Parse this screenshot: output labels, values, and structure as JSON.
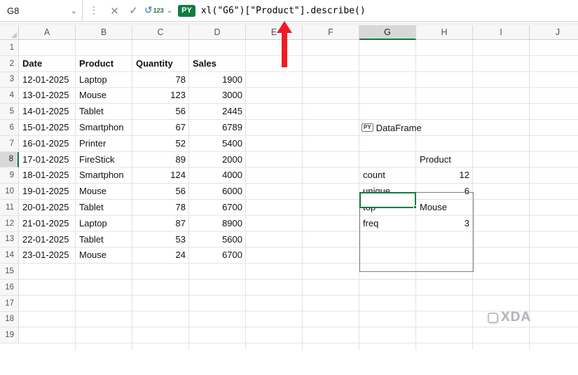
{
  "formula_bar": {
    "cell_reference": "G8",
    "formula": "xl(\"G6\")[\"Product\"].describe()",
    "py_badge": "PY",
    "output_type_label": "123"
  },
  "sheet": {
    "columns": [
      "A",
      "B",
      "C",
      "D",
      "E",
      "F",
      "G",
      "H",
      "I",
      "J"
    ],
    "row_count": 19,
    "selected_column": "G",
    "selected_row": 8,
    "cells": [
      {
        "col": "A",
        "row": 2,
        "text": "Date",
        "align": "left",
        "bold": true
      },
      {
        "col": "B",
        "row": 2,
        "text": "Product",
        "align": "left",
        "bold": true
      },
      {
        "col": "C",
        "row": 2,
        "text": "Quantity",
        "align": "left",
        "bold": true
      },
      {
        "col": "D",
        "row": 2,
        "text": "Sales",
        "align": "left",
        "bold": true
      },
      {
        "col": "A",
        "row": 3,
        "text": "12-01-2025",
        "align": "left",
        "bold": false
      },
      {
        "col": "B",
        "row": 3,
        "text": "Laptop",
        "align": "left",
        "bold": false
      },
      {
        "col": "C",
        "row": 3,
        "text": "78",
        "align": "right",
        "bold": false
      },
      {
        "col": "D",
        "row": 3,
        "text": "1900",
        "align": "right",
        "bold": false
      },
      {
        "col": "A",
        "row": 4,
        "text": "13-01-2025",
        "align": "left",
        "bold": false
      },
      {
        "col": "B",
        "row": 4,
        "text": "Mouse",
        "align": "left",
        "bold": false
      },
      {
        "col": "C",
        "row": 4,
        "text": "123",
        "align": "right",
        "bold": false
      },
      {
        "col": "D",
        "row": 4,
        "text": "3000",
        "align": "right",
        "bold": false
      },
      {
        "col": "A",
        "row": 5,
        "text": "14-01-2025",
        "align": "left",
        "bold": false
      },
      {
        "col": "B",
        "row": 5,
        "text": "Tablet",
        "align": "left",
        "bold": false
      },
      {
        "col": "C",
        "row": 5,
        "text": "56",
        "align": "right",
        "bold": false
      },
      {
        "col": "D",
        "row": 5,
        "text": "2445",
        "align": "right",
        "bold": false
      },
      {
        "col": "A",
        "row": 6,
        "text": "15-01-2025",
        "align": "left",
        "bold": false
      },
      {
        "col": "B",
        "row": 6,
        "text": "Smartphon",
        "align": "left",
        "bold": false
      },
      {
        "col": "C",
        "row": 6,
        "text": "67",
        "align": "right",
        "bold": false
      },
      {
        "col": "D",
        "row": 6,
        "text": "6789",
        "align": "right",
        "bold": false
      },
      {
        "col": "A",
        "row": 7,
        "text": "16-01-2025",
        "align": "left",
        "bold": false
      },
      {
        "col": "B",
        "row": 7,
        "text": "Printer",
        "align": "left",
        "bold": false
      },
      {
        "col": "C",
        "row": 7,
        "text": "52",
        "align": "right",
        "bold": false
      },
      {
        "col": "D",
        "row": 7,
        "text": "5400",
        "align": "right",
        "bold": false
      },
      {
        "col": "A",
        "row": 8,
        "text": "17-01-2025",
        "align": "left",
        "bold": false
      },
      {
        "col": "B",
        "row": 8,
        "text": "FireStick",
        "align": "left",
        "bold": false
      },
      {
        "col": "C",
        "row": 8,
        "text": "89",
        "align": "right",
        "bold": false
      },
      {
        "col": "D",
        "row": 8,
        "text": "2000",
        "align": "right",
        "bold": false
      },
      {
        "col": "A",
        "row": 9,
        "text": "18-01-2025",
        "align": "left",
        "bold": false
      },
      {
        "col": "B",
        "row": 9,
        "text": "Smartphon",
        "align": "left",
        "bold": false
      },
      {
        "col": "C",
        "row": 9,
        "text": "124",
        "align": "right",
        "bold": false
      },
      {
        "col": "D",
        "row": 9,
        "text": "4000",
        "align": "right",
        "bold": false
      },
      {
        "col": "A",
        "row": 10,
        "text": "19-01-2025",
        "align": "left",
        "bold": false
      },
      {
        "col": "B",
        "row": 10,
        "text": "Mouse",
        "align": "left",
        "bold": false
      },
      {
        "col": "C",
        "row": 10,
        "text": "56",
        "align": "right",
        "bold": false
      },
      {
        "col": "D",
        "row": 10,
        "text": "6000",
        "align": "right",
        "bold": false
      },
      {
        "col": "A",
        "row": 11,
        "text": "20-01-2025",
        "align": "left",
        "bold": false
      },
      {
        "col": "B",
        "row": 11,
        "text": "Tablet",
        "align": "left",
        "bold": false
      },
      {
        "col": "C",
        "row": 11,
        "text": "78",
        "align": "right",
        "bold": false
      },
      {
        "col": "D",
        "row": 11,
        "text": "6700",
        "align": "right",
        "bold": false
      },
      {
        "col": "A",
        "row": 12,
        "text": "21-01-2025",
        "align": "left",
        "bold": false
      },
      {
        "col": "B",
        "row": 12,
        "text": "Laptop",
        "align": "left",
        "bold": false
      },
      {
        "col": "C",
        "row": 12,
        "text": "87",
        "align": "right",
        "bold": false
      },
      {
        "col": "D",
        "row": 12,
        "text": "8900",
        "align": "right",
        "bold": false
      },
      {
        "col": "A",
        "row": 13,
        "text": "22-01-2025",
        "align": "left",
        "bold": false
      },
      {
        "col": "B",
        "row": 13,
        "text": "Tablet",
        "align": "left",
        "bold": false
      },
      {
        "col": "C",
        "row": 13,
        "text": "53",
        "align": "right",
        "bold": false
      },
      {
        "col": "D",
        "row": 13,
        "text": "5600",
        "align": "right",
        "bold": false
      },
      {
        "col": "A",
        "row": 14,
        "text": "23-01-2025",
        "align": "left",
        "bold": false
      },
      {
        "col": "B",
        "row": 14,
        "text": "Mouse",
        "align": "left",
        "bold": false
      },
      {
        "col": "C",
        "row": 14,
        "text": "24",
        "align": "right",
        "bold": false
      },
      {
        "col": "D",
        "row": 14,
        "text": "6700",
        "align": "right",
        "bold": false
      },
      {
        "col": "H",
        "row": 8,
        "text": "Product",
        "align": "left",
        "bold": false
      },
      {
        "col": "G",
        "row": 9,
        "text": "count",
        "align": "left",
        "bold": false
      },
      {
        "col": "H",
        "row": 9,
        "text": "12",
        "align": "right",
        "bold": false
      },
      {
        "col": "G",
        "row": 10,
        "text": "unique",
        "align": "left",
        "bold": false
      },
      {
        "col": "H",
        "row": 10,
        "text": "6",
        "align": "right",
        "bold": false
      },
      {
        "col": "G",
        "row": 11,
        "text": "top",
        "align": "left",
        "bold": false
      },
      {
        "col": "H",
        "row": 11,
        "text": "Mouse",
        "align": "left",
        "bold": false
      },
      {
        "col": "G",
        "row": 12,
        "text": "freq",
        "align": "left",
        "bold": false
      },
      {
        "col": "H",
        "row": 12,
        "text": "3",
        "align": "right",
        "bold": false
      }
    ]
  },
  "dataframe_cell": {
    "icon": "PY",
    "label": "DataFrame"
  },
  "colors": {
    "excel_green": "#107c41",
    "arrow_red": "#ed1c24"
  },
  "watermark": {
    "text": "XDA"
  }
}
